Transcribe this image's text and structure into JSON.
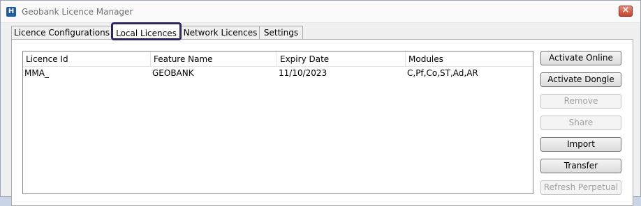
{
  "window": {
    "title": "Geobank Licence Manager",
    "app_icon_glyph": "H",
    "close_glyph": "×"
  },
  "tabs": [
    {
      "label": "Licence Configurations",
      "active": false
    },
    {
      "label": "Local Licences",
      "active": true
    },
    {
      "label": "Network Licences",
      "active": false
    },
    {
      "label": "Settings",
      "active": false
    }
  ],
  "licence_table": {
    "columns": [
      "Licence Id",
      "Feature Name",
      "Expiry Date",
      "Modules"
    ],
    "rows": [
      [
        "MMA_",
        "GEOBANK",
        "11/10/2023",
        "C,Pf,Co,ST,Ad,AR"
      ]
    ]
  },
  "actions": [
    {
      "label": "Activate Online",
      "enabled": true
    },
    {
      "label": "Activate Dongle",
      "enabled": true
    },
    {
      "label": "Remove",
      "enabled": false
    },
    {
      "label": "Share",
      "enabled": false
    },
    {
      "label": "Import",
      "enabled": true
    },
    {
      "label": "Transfer",
      "enabled": true
    },
    {
      "label": "Refresh Perpetual",
      "enabled": false
    }
  ],
  "colors": {
    "active_tab_highlight": "#2d2462",
    "close_button": "#c4452f",
    "app_icon": "#1e5aa8"
  }
}
